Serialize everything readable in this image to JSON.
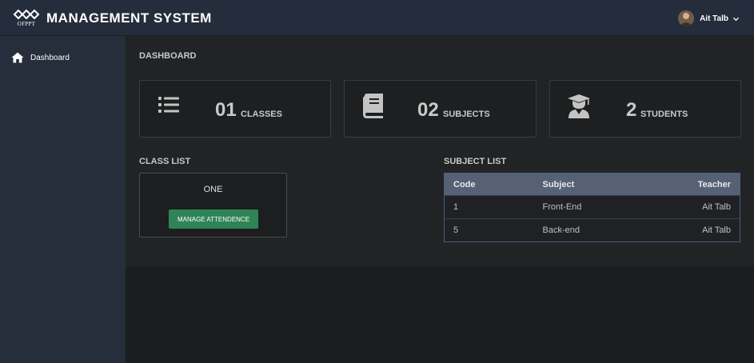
{
  "header": {
    "logo_text": "OFPPT",
    "title": "MANAGEMENT SYSTEM",
    "user_name": "Ait Talb"
  },
  "sidebar": {
    "items": [
      {
        "label": "Dashboard",
        "icon": "home-icon"
      }
    ]
  },
  "main": {
    "page_title": "DASHBOARD",
    "cards": [
      {
        "value": "01",
        "label": "CLASSES",
        "icon": "list-icon"
      },
      {
        "value": "02",
        "label": "SUBJECTS",
        "icon": "book-icon"
      },
      {
        "value": "2",
        "label": "STUDENTS",
        "icon": "graduate-icon"
      }
    ],
    "class_list": {
      "title": "CLASS LIST",
      "class_name": "ONE",
      "button_label": "MANAGE ATTENDENCE"
    },
    "subject_list": {
      "title": "SUBJECT LIST",
      "columns": [
        "Code",
        "Subject",
        "Teacher"
      ],
      "rows": [
        {
          "code": "1",
          "subject": "Front-End",
          "teacher": "Ait Talb"
        },
        {
          "code": "5",
          "subject": "Back-end",
          "teacher": "Ait Talb"
        }
      ]
    }
  },
  "colors": {
    "topbar": "#252c3b",
    "sidebar": "#262d3b",
    "button_green": "#2f8456",
    "table_header": "#566175"
  }
}
